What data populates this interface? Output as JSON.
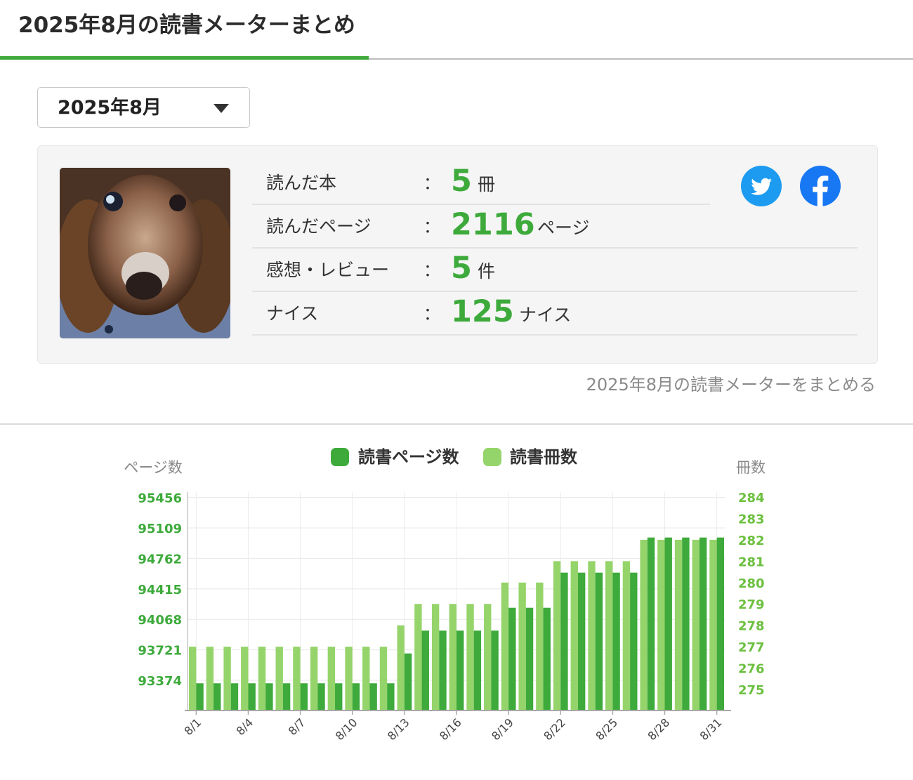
{
  "page": {
    "title": "2025年8月の読書メーターまとめ"
  },
  "month_select": {
    "value": "2025年8月"
  },
  "stats": [
    {
      "label": "読んだ本",
      "colon": "：",
      "value": "5",
      "unit": "冊"
    },
    {
      "label": "読んだページ",
      "colon": "：",
      "value": "2116",
      "unit": "ページ"
    },
    {
      "label": "感想・レビュー",
      "colon": "：",
      "value": "5",
      "unit": "件"
    },
    {
      "label": "ナイス",
      "colon": "：",
      "value": "125",
      "unit": "ナイス"
    }
  ],
  "social": {
    "twitter_icon": "twitter-icon",
    "facebook_icon": "facebook-icon",
    "twitter_color": "#1d9bf0",
    "facebook_color": "#1877f2"
  },
  "share_link": "2025年8月の読書メーターをまとめる",
  "colors": {
    "accent": "#3daa3b",
    "pages_series": "#3daa3b",
    "books_series": "#95d46a"
  },
  "chart_data": {
    "type": "bar",
    "legend": [
      "読書ページ数",
      "読書冊数"
    ],
    "legend_position": "top-center",
    "grid": true,
    "left_axis": {
      "title": "ページ数",
      "ticks": [
        93374,
        93721,
        94068,
        94415,
        94762,
        95109,
        95456
      ]
    },
    "right_axis": {
      "title": "冊数",
      "ticks": [
        275,
        276,
        277,
        278,
        279,
        280,
        281,
        282,
        283,
        284
      ]
    },
    "x_tick_labels": [
      "8/1",
      "8/4",
      "8/7",
      "8/10",
      "8/13",
      "8/16",
      "8/19",
      "8/22",
      "8/25",
      "8/28",
      "8/31"
    ],
    "categories": [
      "8/1",
      "8/2",
      "8/3",
      "8/4",
      "8/5",
      "8/6",
      "8/7",
      "8/8",
      "8/9",
      "8/10",
      "8/11",
      "8/12",
      "8/13",
      "8/14",
      "8/15",
      "8/16",
      "8/17",
      "8/18",
      "8/19",
      "8/20",
      "8/21",
      "8/22",
      "8/23",
      "8/24",
      "8/25",
      "8/26",
      "8/27",
      "8/28",
      "8/29",
      "8/30",
      "8/31"
    ],
    "series": [
      {
        "name": "読書ページ数",
        "axis": "left",
        "values": [
          93340,
          93340,
          93340,
          93340,
          93340,
          93340,
          93340,
          93340,
          93340,
          93340,
          93340,
          93340,
          93680,
          93940,
          93940,
          93940,
          93940,
          93940,
          94200,
          94200,
          94200,
          94600,
          94600,
          94600,
          94600,
          94600,
          95000,
          95000,
          95000,
          95000,
          95000
        ]
      },
      {
        "name": "読書冊数",
        "axis": "right",
        "values": [
          277,
          277,
          277,
          277,
          277,
          277,
          277,
          277,
          277,
          277,
          277,
          277,
          278,
          279,
          279,
          279,
          279,
          279,
          280,
          280,
          280,
          281,
          281,
          281,
          281,
          281,
          282,
          282,
          282,
          282,
          282
        ]
      }
    ]
  }
}
